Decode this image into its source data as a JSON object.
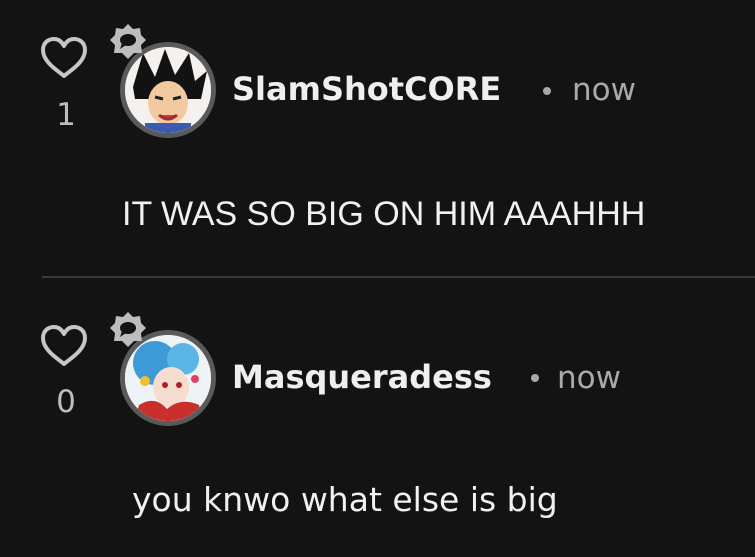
{
  "comments": [
    {
      "likes": "1",
      "username": "SlamShotCORE",
      "timestamp": "now",
      "text": "IT WAS SO BIG ON HIM AAAHHH"
    },
    {
      "likes": "0",
      "username": "Masqueradess",
      "timestamp": "now",
      "text": "you knwo what else is big"
    }
  ],
  "icons": {
    "like": "heart-outline-icon",
    "badge": "chat-bubble-badge-icon"
  },
  "colors": {
    "background": "#141313",
    "text": "#f2f1f1",
    "muted": "#a9a9a9",
    "divider": "#3a3939",
    "avatar_ring": "#5a5a5a"
  }
}
